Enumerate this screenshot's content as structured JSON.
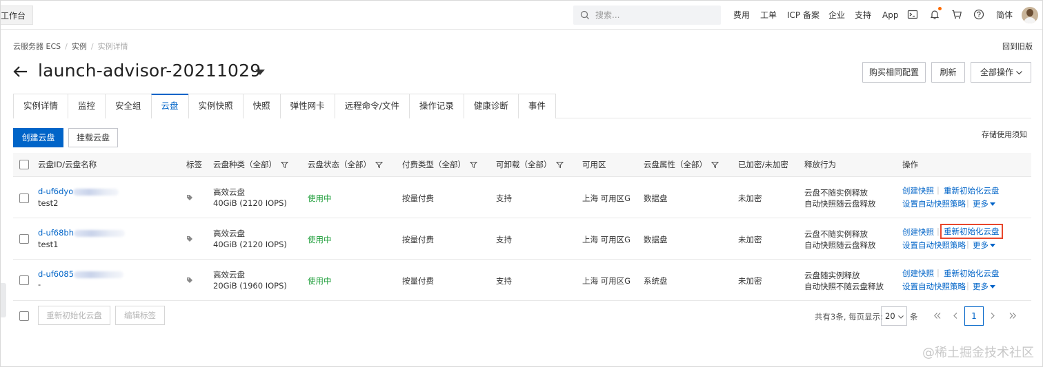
{
  "topbar": {
    "workbench": "工作台",
    "search_placeholder": "搜索...",
    "nav": [
      "费用",
      "工单",
      "ICP 备案",
      "企业",
      "支持",
      "App"
    ],
    "lang": "简体"
  },
  "breadcrumb": [
    "云服务器 ECS",
    "实例",
    "实例详情"
  ],
  "back_to_old": "回到旧版",
  "title": "launch-advisor-20211029",
  "header_buttons": {
    "buy_same": "购买相同配置",
    "refresh": "刷新",
    "all_ops": "全部操作"
  },
  "tabs": [
    "实例详情",
    "监控",
    "安全组",
    "云盘",
    "实例快照",
    "快照",
    "弹性网卡",
    "远程命令/文件",
    "操作记录",
    "健康诊断",
    "事件"
  ],
  "active_tab": "云盘",
  "toolbar": {
    "create_disk": "创建云盘",
    "attach_disk": "挂载云盘",
    "storage_notice": "存储使用须知"
  },
  "table": {
    "headers": [
      "云盘ID/云盘名称",
      "标签",
      "云盘种类（全部）",
      "云盘状态（全部）",
      "付费类型（全部）",
      "可卸载（全部）",
      "可用区",
      "云盘属性（全部）",
      "已加密/未加密",
      "释放行为",
      "操作"
    ],
    "rows": [
      {
        "id": "d-uf6dyo",
        "name": "test2",
        "type": "高效云盘",
        "spec": "40GiB (2120 IOPS)",
        "status": "使用中",
        "pay": "按量付费",
        "detach": "支持",
        "zone": "上海 可用区G",
        "attr": "数据盘",
        "enc": "未加密",
        "release1": "云盘不随实例释放",
        "release2": "自动快照随云盘释放",
        "op_snapshot": "创建快照",
        "op_reinit": "重新初始化云盘",
        "op_policy": "设置自动快照策略",
        "op_more": "更多"
      },
      {
        "id": "d-uf68bh",
        "name": "test1",
        "type": "高效云盘",
        "spec": "40GiB (2120 IOPS)",
        "status": "使用中",
        "pay": "按量付费",
        "detach": "支持",
        "zone": "上海 可用区G",
        "attr": "数据盘",
        "enc": "未加密",
        "release1": "云盘不随实例释放",
        "release2": "自动快照随云盘释放",
        "op_snapshot": "创建快照",
        "op_reinit": "重新初始化云盘",
        "op_policy": "设置自动快照策略",
        "op_more": "更多"
      },
      {
        "id": "d-uf6085",
        "name": "-",
        "type": "高效云盘",
        "spec": "20GiB (1960 IOPS)",
        "status": "使用中",
        "pay": "按量付费",
        "detach": "支持",
        "zone": "上海 可用区G",
        "attr": "系统盘",
        "enc": "未加密",
        "release1": "云盘随实例释放",
        "release2": "自动快照不随云盘释放",
        "op_snapshot": "创建快照",
        "op_reinit": "重新初始化云盘",
        "op_policy": "设置自动快照策略",
        "op_more": "更多"
      }
    ]
  },
  "footer": {
    "reinit_btn": "重新初始化云盘",
    "edit_tags_btn": "编辑标签",
    "total": "共有3条, 每页显示:",
    "page_size": "20",
    "page_unit": "条",
    "current_page": "1"
  },
  "watermark": "@稀土掘金技术社区",
  "colors": {
    "primary": "#0064c8",
    "status_green": "#1e9e3a",
    "highlight": "#e8462b"
  }
}
